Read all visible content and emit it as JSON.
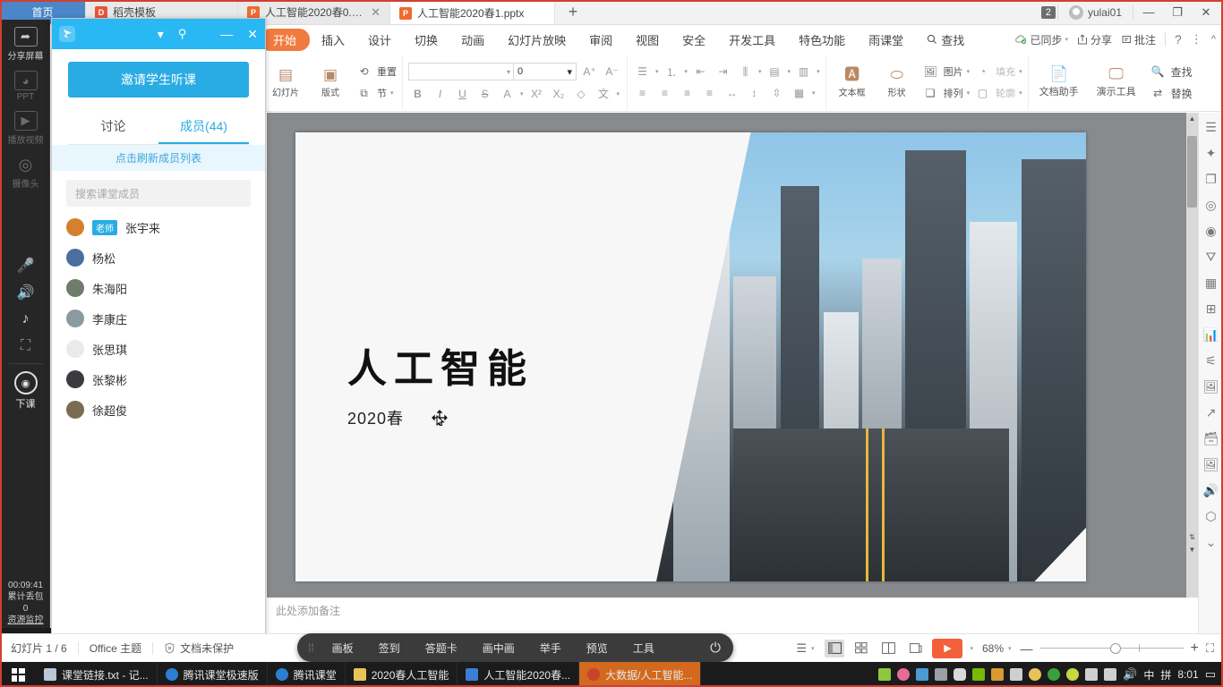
{
  "window": {
    "tabs": [
      {
        "label": "首页",
        "icon": "home-icon",
        "type": "home"
      },
      {
        "label": "稻壳模板",
        "icon": "docer-icon",
        "type": "docer"
      },
      {
        "label": "人工智能2020春0.pptx",
        "icon": "ppt-icon",
        "type": "doc",
        "active": false
      },
      {
        "label": "人工智能2020春1.pptx",
        "icon": "ppt-icon",
        "type": "doc",
        "active": true
      }
    ],
    "add_tab": "+",
    "notify_count": "2",
    "user": "yulai01",
    "minimize": "—",
    "maximize": "❐",
    "close": "✕"
  },
  "ribbon": {
    "tabs": [
      {
        "label": "开始",
        "active": true
      },
      {
        "label": "插入",
        "active": false
      },
      {
        "label": "设计",
        "active": false
      },
      {
        "label": "切换",
        "active": false
      },
      {
        "label": "动画",
        "active": false
      },
      {
        "label": "幻灯片放映",
        "active": false
      },
      {
        "label": "审阅",
        "active": false
      },
      {
        "label": "视图",
        "active": false
      },
      {
        "label": "安全",
        "active": false
      },
      {
        "label": "开发工具",
        "active": false
      },
      {
        "label": "特色功能",
        "active": false
      },
      {
        "label": "雨课堂",
        "active": false
      },
      {
        "label": "查找",
        "active": false,
        "icon": "search-icon"
      }
    ],
    "right": {
      "sync": "已同步",
      "share": "分享",
      "comment": "批注",
      "help": "?",
      "more": "⋮",
      "collapse": "^"
    },
    "groups": {
      "slide_label": "幻灯片",
      "layout_label": "版式",
      "reset_label": "重置",
      "section_label": "节",
      "font_name": "",
      "font_size": "0",
      "grow_font": "A",
      "shrink_font": "A",
      "bold": "B",
      "italic": "I",
      "underline": "U",
      "strike": "S",
      "font_color": "A",
      "superscript": "X²",
      "subscript": "X₂",
      "clear_format": "◇",
      "pinyin": "文",
      "textbox_label": "文本框",
      "shape_label": "形状",
      "arrange_label": "排列",
      "picture_label": "图片",
      "fill_label": "填充",
      "outline_label": "轮廓",
      "doc_assistant_label": "文档助手",
      "present_tool_label": "演示工具",
      "find_label": "查找",
      "replace_label": "替换"
    }
  },
  "dock": {
    "items": [
      {
        "label": "分享屏幕",
        "icon": "share-screen-icon",
        "dim": false
      },
      {
        "label": "PPT",
        "icon": "ppt-icon",
        "dim": true
      },
      {
        "label": "播放视频",
        "icon": "play-video-icon",
        "dim": true
      },
      {
        "label": "摄像头",
        "icon": "camera-icon",
        "dim": true
      }
    ],
    "controls": [
      {
        "icon": "microphone-icon",
        "name": "mic"
      },
      {
        "icon": "speaker-icon",
        "name": "speaker"
      },
      {
        "icon": "music-icon",
        "name": "music"
      },
      {
        "icon": "fullscreen-icon",
        "name": "fullscreen"
      }
    ],
    "end_class": "下课",
    "timer": "00:09:41",
    "packet_loss_label": "累计丢包",
    "packet_loss_value": "0",
    "resource_monitor": "资源监控"
  },
  "panel": {
    "invite_button": "邀请学生听课",
    "tabs": [
      {
        "label": "讨论",
        "active": false
      },
      {
        "label": "成员(44)",
        "active": true
      }
    ],
    "refresh": "点击刷新成员列表",
    "search_placeholder": "搜索课堂成员",
    "members": [
      {
        "name": "张宇来",
        "tag": "老师",
        "color": "#d4802f"
      },
      {
        "name": "杨松",
        "tag": "",
        "color": "#4a6fa0"
      },
      {
        "name": "朱海阳",
        "tag": "",
        "color": "#6e7d6b"
      },
      {
        "name": "李康庄",
        "tag": "",
        "color": "#8b9aa2"
      },
      {
        "name": "张思琪",
        "tag": "",
        "color": "#e8eaec"
      },
      {
        "name": "张黎彬",
        "tag": "",
        "color": "#3b3b3f"
      },
      {
        "name": "徐超俊",
        "tag": "",
        "color": "#7b6b52"
      }
    ],
    "minimize": "—",
    "close": "✕",
    "dropdown": "▾",
    "pin": "📌"
  },
  "slide": {
    "title": "人工智能",
    "subtitle": "2020春",
    "notes_placeholder": "此处添加备注"
  },
  "floatbar": {
    "items": [
      "画板",
      "签到",
      "答题卡",
      "画中画",
      "举手",
      "预览",
      "工具"
    ],
    "power": "⏻"
  },
  "statusbar": {
    "slide_index": "幻灯片 1 / 6",
    "theme": "Office 主题",
    "protection": "文档未保护",
    "zoom": "68%",
    "zoom_out": "—",
    "zoom_in": "+",
    "views": [
      "normal-view",
      "slide-sorter-view",
      "reading-view",
      "presenter-view"
    ]
  },
  "taskbar": {
    "apps": [
      {
        "label": "课堂链接.txt - 记...",
        "color": "#b9c7d6",
        "active": false
      },
      {
        "label": "腾讯课堂极速版",
        "color": "#2b7fd4",
        "active": false
      },
      {
        "label": "腾讯课堂",
        "color": "#2b7fd4",
        "active": false
      },
      {
        "label": "2020春人工智能",
        "color": "#e8c35a",
        "active": false
      },
      {
        "label": "人工智能2020春...",
        "color": "#3b7fd4",
        "active": false
      },
      {
        "label": "大数据/人工智能...",
        "color": "#c9432c",
        "active": true
      }
    ],
    "tray": [
      {
        "icon": "usb-icon",
        "color": "#8ec63f"
      },
      {
        "icon": "flower-icon",
        "color": "#e86a9a"
      },
      {
        "icon": "box-icon",
        "color": "#4a9ad4"
      },
      {
        "icon": "pen-icon",
        "color": "#9aa0a6"
      },
      {
        "icon": "mic-icon",
        "color": "#d8d8d8"
      },
      {
        "icon": "nvidia-icon",
        "color": "#76b900"
      },
      {
        "icon": "save-icon",
        "color": "#d99a33"
      },
      {
        "icon": "usb-drive-icon",
        "color": "#cfcfcf"
      },
      {
        "icon": "qq-icon",
        "color": "#e8c35a"
      },
      {
        "icon": "shield-icon",
        "color": "#3aa03a"
      },
      {
        "icon": "leaf-icon",
        "color": "#c8d63f"
      },
      {
        "icon": "monitor-icon",
        "color": "#cfcfcf"
      },
      {
        "icon": "network-icon",
        "color": "#cfcfcf"
      },
      {
        "icon": "volume-icon",
        "color": "#cfcfcf"
      }
    ],
    "ime_mode": "中",
    "ime_type": "拼",
    "clock": "8:01",
    "action_center": "notification-icon"
  }
}
